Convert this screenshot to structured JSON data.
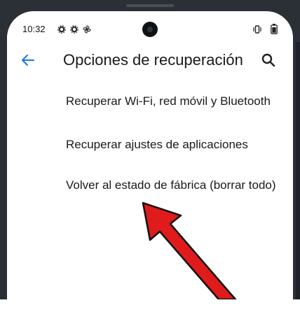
{
  "status_bar": {
    "time": "10:32"
  },
  "header": {
    "title": "Opciones de recuperación"
  },
  "options": [
    {
      "label": "Recuperar Wi-Fi, red móvil y Bluetooth"
    },
    {
      "label": "Recuperar ajustes de aplicaciones"
    },
    {
      "label": "Volver al estado de fábrica (borrar todo)"
    }
  ],
  "colors": {
    "accent": "#1a73e8",
    "arrow": "#e01b1b",
    "frame": "#2b2f36"
  }
}
